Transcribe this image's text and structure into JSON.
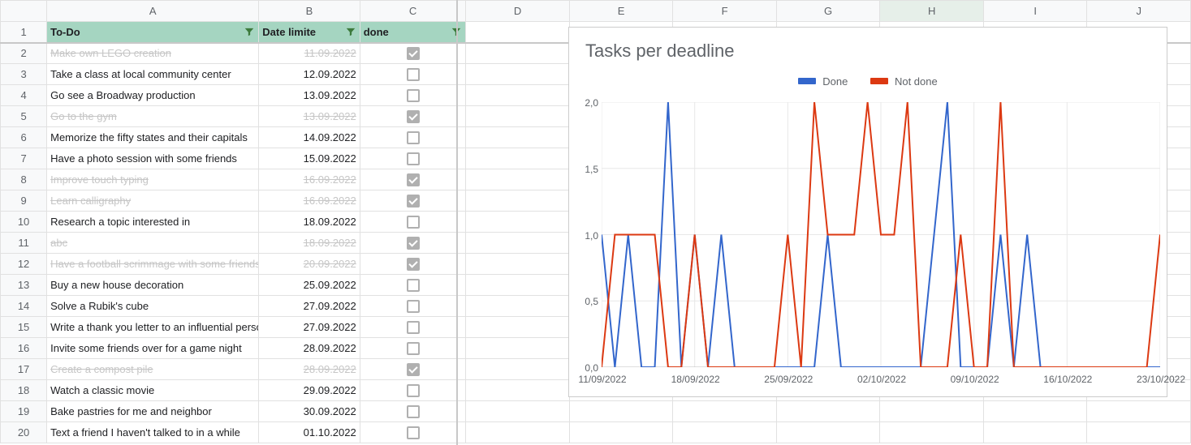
{
  "columns": [
    "A",
    "B",
    "C",
    "D",
    "E",
    "F",
    "G",
    "H",
    "I",
    "J"
  ],
  "selected_col": "H",
  "header": {
    "a": "To-Do",
    "b": "Date limite",
    "c": "done"
  },
  "rows": [
    {
      "n": 2,
      "task": "Make own LEGO creation",
      "date": "11.09.2022",
      "done": true
    },
    {
      "n": 3,
      "task": "Take a class at local community center",
      "date": "12.09.2022",
      "done": false
    },
    {
      "n": 4,
      "task": "Go see a Broadway production",
      "date": "13.09.2022",
      "done": false
    },
    {
      "n": 5,
      "task": "Go to the gym",
      "date": "13.09.2022",
      "done": true
    },
    {
      "n": 6,
      "task": "Memorize the fifty states and their capitals",
      "date": "14.09.2022",
      "done": false
    },
    {
      "n": 7,
      "task": "Have a photo session with some friends",
      "date": "15.09.2022",
      "done": false
    },
    {
      "n": 8,
      "task": "Improve touch typing",
      "date": "16.09.2022",
      "done": true
    },
    {
      "n": 9,
      "task": "Learn calligraphy",
      "date": "16.09.2022",
      "done": true
    },
    {
      "n": 10,
      "task": "Research a topic interested in",
      "date": "18.09.2022",
      "done": false
    },
    {
      "n": 11,
      "task": "abc",
      "date": "18.09.2022",
      "done": true
    },
    {
      "n": 12,
      "task": "Have a football scrimmage with some friends",
      "date": "20.09.2022",
      "done": true
    },
    {
      "n": 13,
      "task": "Buy a new house decoration",
      "date": "25.09.2022",
      "done": false
    },
    {
      "n": 14,
      "task": "Solve a Rubik's cube",
      "date": "27.09.2022",
      "done": false
    },
    {
      "n": 15,
      "task": "Write a thank you letter to an influential person",
      "date": "27.09.2022",
      "done": false
    },
    {
      "n": 16,
      "task": "Invite some friends over for a game night",
      "date": "28.09.2022",
      "done": false
    },
    {
      "n": 17,
      "task": "Create a compost pile",
      "date": "28.09.2022",
      "done": true
    },
    {
      "n": 18,
      "task": "Watch a classic movie",
      "date": "29.09.2022",
      "done": false
    },
    {
      "n": 19,
      "task": "Bake pastries for me and neighbor",
      "date": "30.09.2022",
      "done": false
    },
    {
      "n": 20,
      "task": "Text a friend I haven't talked to in a while",
      "date": "01.10.2022",
      "done": false
    }
  ],
  "chart_data": {
    "type": "line",
    "title": "Tasks per deadline",
    "ylabel": "",
    "xlabel": "",
    "ylim": [
      0,
      2
    ],
    "y_ticks": [
      "0,0",
      "0,5",
      "1,0",
      "1,5",
      "2,0"
    ],
    "x_ticks": [
      "11/09/2022",
      "18/09/2022",
      "25/09/2022",
      "02/10/2022",
      "09/10/2022",
      "16/10/2022",
      "23/10/2022"
    ],
    "x_start": "11/09/2022",
    "x_end": "23/10/2022",
    "legend": [
      "Done",
      "Not done"
    ],
    "series": [
      {
        "name": "Done",
        "color": "#3366cc",
        "points": [
          {
            "x": "11/09/2022",
            "y": 1
          },
          {
            "x": "12/09/2022",
            "y": 0
          },
          {
            "x": "13/09/2022",
            "y": 1
          },
          {
            "x": "14/09/2022",
            "y": 0
          },
          {
            "x": "15/09/2022",
            "y": 0
          },
          {
            "x": "16/09/2022",
            "y": 2
          },
          {
            "x": "17/09/2022",
            "y": 0
          },
          {
            "x": "18/09/2022",
            "y": 1
          },
          {
            "x": "19/09/2022",
            "y": 0
          },
          {
            "x": "20/09/2022",
            "y": 1
          },
          {
            "x": "21/09/2022",
            "y": 0
          },
          {
            "x": "22/09/2022",
            "y": 0
          },
          {
            "x": "23/09/2022",
            "y": 0
          },
          {
            "x": "24/09/2022",
            "y": 0
          },
          {
            "x": "25/09/2022",
            "y": 0
          },
          {
            "x": "26/09/2022",
            "y": 0
          },
          {
            "x": "27/09/2022",
            "y": 0
          },
          {
            "x": "28/09/2022",
            "y": 1
          },
          {
            "x": "29/09/2022",
            "y": 0
          },
          {
            "x": "30/09/2022",
            "y": 0
          },
          {
            "x": "01/10/2022",
            "y": 0
          },
          {
            "x": "02/10/2022",
            "y": 0
          },
          {
            "x": "03/10/2022",
            "y": 0
          },
          {
            "x": "04/10/2022",
            "y": 0
          },
          {
            "x": "05/10/2022",
            "y": 0
          },
          {
            "x": "06/10/2022",
            "y": 1
          },
          {
            "x": "07/10/2022",
            "y": 2
          },
          {
            "x": "08/10/2022",
            "y": 0
          },
          {
            "x": "09/10/2022",
            "y": 0
          },
          {
            "x": "10/10/2022",
            "y": 0
          },
          {
            "x": "11/10/2022",
            "y": 1
          },
          {
            "x": "12/10/2022",
            "y": 0
          },
          {
            "x": "13/10/2022",
            "y": 1
          },
          {
            "x": "14/10/2022",
            "y": 0
          },
          {
            "x": "15/10/2022",
            "y": 0
          },
          {
            "x": "16/10/2022",
            "y": 0
          },
          {
            "x": "17/10/2022",
            "y": 0
          },
          {
            "x": "18/10/2022",
            "y": 0
          },
          {
            "x": "19/10/2022",
            "y": 0
          },
          {
            "x": "20/10/2022",
            "y": 0
          },
          {
            "x": "21/10/2022",
            "y": 0
          },
          {
            "x": "22/10/2022",
            "y": 0
          },
          {
            "x": "23/10/2022",
            "y": 0
          }
        ]
      },
      {
        "name": "Not done",
        "color": "#dc3912",
        "points": [
          {
            "x": "11/09/2022",
            "y": 0
          },
          {
            "x": "12/09/2022",
            "y": 1
          },
          {
            "x": "13/09/2022",
            "y": 1
          },
          {
            "x": "14/09/2022",
            "y": 1
          },
          {
            "x": "15/09/2022",
            "y": 1
          },
          {
            "x": "16/09/2022",
            "y": 0
          },
          {
            "x": "17/09/2022",
            "y": 0
          },
          {
            "x": "18/09/2022",
            "y": 1
          },
          {
            "x": "19/09/2022",
            "y": 0
          },
          {
            "x": "20/09/2022",
            "y": 0
          },
          {
            "x": "21/09/2022",
            "y": 0
          },
          {
            "x": "22/09/2022",
            "y": 0
          },
          {
            "x": "23/09/2022",
            "y": 0
          },
          {
            "x": "24/09/2022",
            "y": 0
          },
          {
            "x": "25/09/2022",
            "y": 1
          },
          {
            "x": "26/09/2022",
            "y": 0
          },
          {
            "x": "27/09/2022",
            "y": 2
          },
          {
            "x": "28/09/2022",
            "y": 1
          },
          {
            "x": "29/09/2022",
            "y": 1
          },
          {
            "x": "30/09/2022",
            "y": 1
          },
          {
            "x": "01/10/2022",
            "y": 2
          },
          {
            "x": "02/10/2022",
            "y": 1
          },
          {
            "x": "03/10/2022",
            "y": 1
          },
          {
            "x": "04/10/2022",
            "y": 2
          },
          {
            "x": "05/10/2022",
            "y": 0
          },
          {
            "x": "06/10/2022",
            "y": 0
          },
          {
            "x": "07/10/2022",
            "y": 0
          },
          {
            "x": "08/10/2022",
            "y": 1
          },
          {
            "x": "09/10/2022",
            "y": 0
          },
          {
            "x": "10/10/2022",
            "y": 0
          },
          {
            "x": "11/10/2022",
            "y": 2
          },
          {
            "x": "12/10/2022",
            "y": 0
          },
          {
            "x": "13/10/2022",
            "y": 0
          },
          {
            "x": "14/10/2022",
            "y": 0
          },
          {
            "x": "15/10/2022",
            "y": 0
          },
          {
            "x": "16/10/2022",
            "y": 0
          },
          {
            "x": "17/10/2022",
            "y": 0
          },
          {
            "x": "18/10/2022",
            "y": 0
          },
          {
            "x": "19/10/2022",
            "y": 0
          },
          {
            "x": "20/10/2022",
            "y": 0
          },
          {
            "x": "21/10/2022",
            "y": 0
          },
          {
            "x": "22/10/2022",
            "y": 0
          },
          {
            "x": "23/10/2022",
            "y": 1
          }
        ]
      }
    ]
  }
}
